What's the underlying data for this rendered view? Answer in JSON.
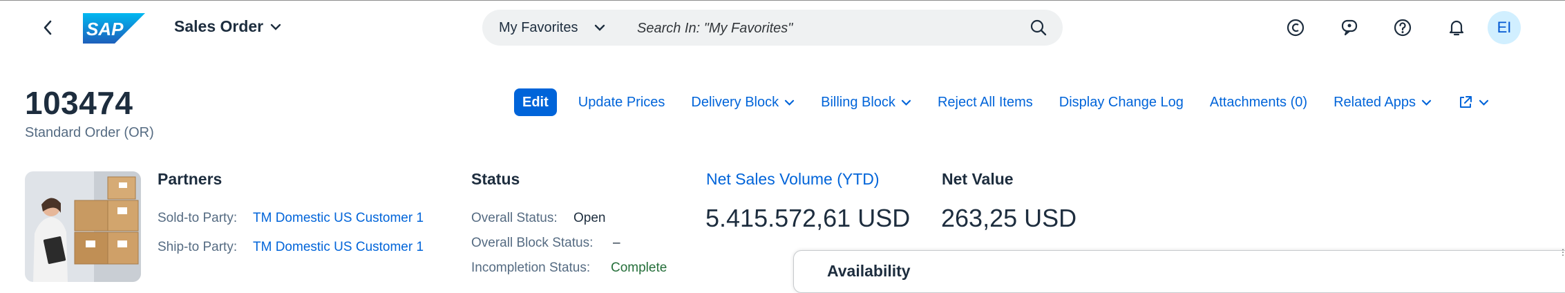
{
  "shell": {
    "app_title": "Sales Order",
    "search_scope": "My Favorites",
    "search_placeholder": "Search In: \"My Favorites\"",
    "avatar_initials": "EI",
    "icons": [
      "back-icon",
      "chevron-down-icon",
      "search-icon",
      "c-circle-icon",
      "feedback-icon",
      "help-icon",
      "bell-icon"
    ]
  },
  "header": {
    "title": "103474",
    "subtitle": "Standard Order (OR)",
    "actions": {
      "edit": "Edit",
      "update_prices": "Update Prices",
      "delivery_block": "Delivery Block",
      "billing_block": "Billing Block",
      "reject_all": "Reject All Items",
      "change_log": "Display Change Log",
      "attachments": "Attachments (0)",
      "related_apps": "Related Apps"
    }
  },
  "partners": {
    "title": "Partners",
    "sold_to_label": "Sold-to Party:",
    "sold_to_value": "TM Domestic US Customer 1",
    "ship_to_label": "Ship-to Party:",
    "ship_to_value": "TM Domestic US Customer 1"
  },
  "status": {
    "title": "Status",
    "overall_label": "Overall Status:",
    "overall_value": "Open",
    "block_label": "Overall Block Status:",
    "block_value": "–",
    "incompletion_label": "Incompletion Status:",
    "incompletion_value": "Complete"
  },
  "kpis": {
    "net_sales_title": "Net Sales Volume (YTD)",
    "net_sales_value": "5.415.572,61",
    "net_sales_unit": "USD",
    "net_value_title": "Net Value",
    "net_value_value": "263,25",
    "net_value_unit": "USD"
  },
  "popover": {
    "title": "Availability"
  },
  "colors": {
    "brand": "#0064d9",
    "text": "#1d2d3e",
    "label": "#556b82",
    "positive": "#256f3a"
  }
}
